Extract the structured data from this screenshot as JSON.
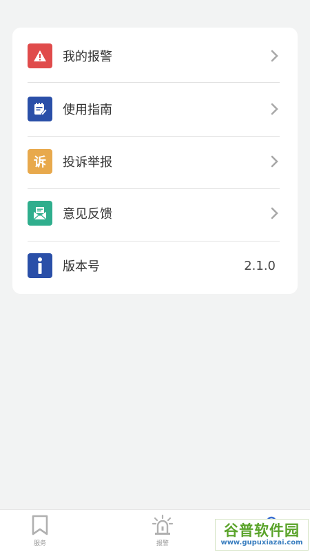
{
  "menu": {
    "items": [
      {
        "label": "我的报警",
        "icon": "alarm-warning-icon",
        "color": "#e04b4b"
      },
      {
        "label": "使用指南",
        "icon": "guide-book-icon",
        "color": "#2a4fa8"
      },
      {
        "label": "投诉举报",
        "icon": "complaint-icon",
        "color": "#e8a94c",
        "glyph": "诉"
      },
      {
        "label": "意见反馈",
        "icon": "feedback-mail-icon",
        "color": "#2fae8d"
      }
    ],
    "version": {
      "label": "版本号",
      "value": "2.1.0",
      "icon": "info-icon",
      "color": "#2a4fa8"
    }
  },
  "tabbar": {
    "tabs": [
      {
        "label": "服务",
        "icon": "bookmark-icon"
      },
      {
        "label": "报警",
        "icon": "siren-icon"
      },
      {
        "label": "",
        "icon": "user-icon"
      }
    ]
  },
  "watermark": {
    "main": "谷普软件园",
    "sub": "www.gupuxiazai.com"
  }
}
